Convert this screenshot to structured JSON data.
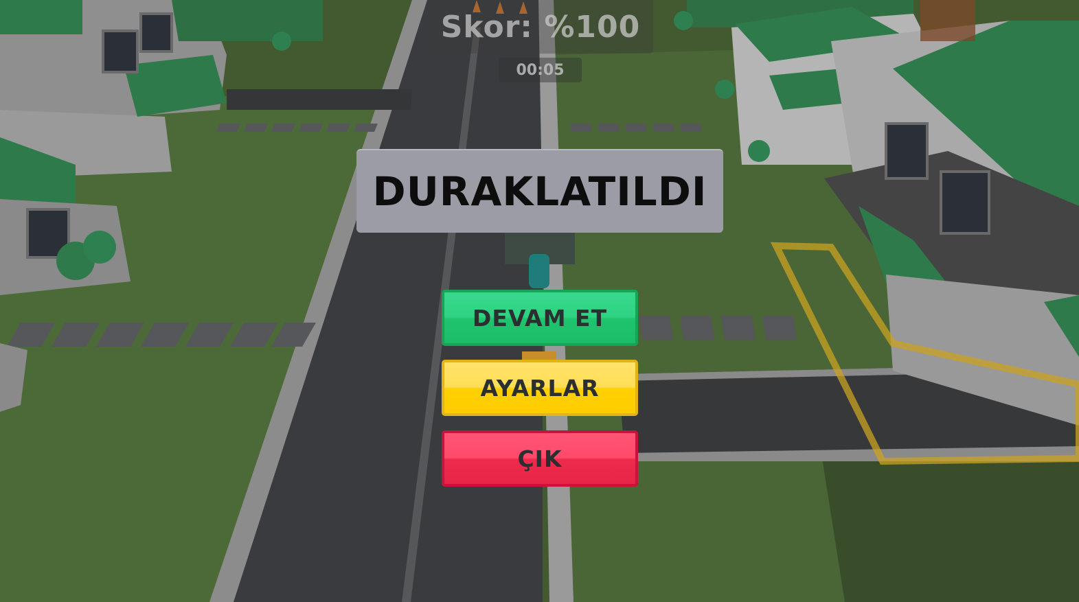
{
  "hud": {
    "score": "Skor: %100",
    "timer": "00:05"
  },
  "pause_menu": {
    "title": "DURAKLATILDI",
    "resume_label": "DEVAM ET",
    "settings_label": "AYARLAR",
    "quit_label": "ÇIK"
  },
  "colors": {
    "resume_button": "#2fd282",
    "settings_button": "#ffd000",
    "quit_button": "#ee2a4c",
    "title_panel": "#9c9ca6",
    "grass": "#4b6536",
    "road": "#3a3a3c"
  }
}
